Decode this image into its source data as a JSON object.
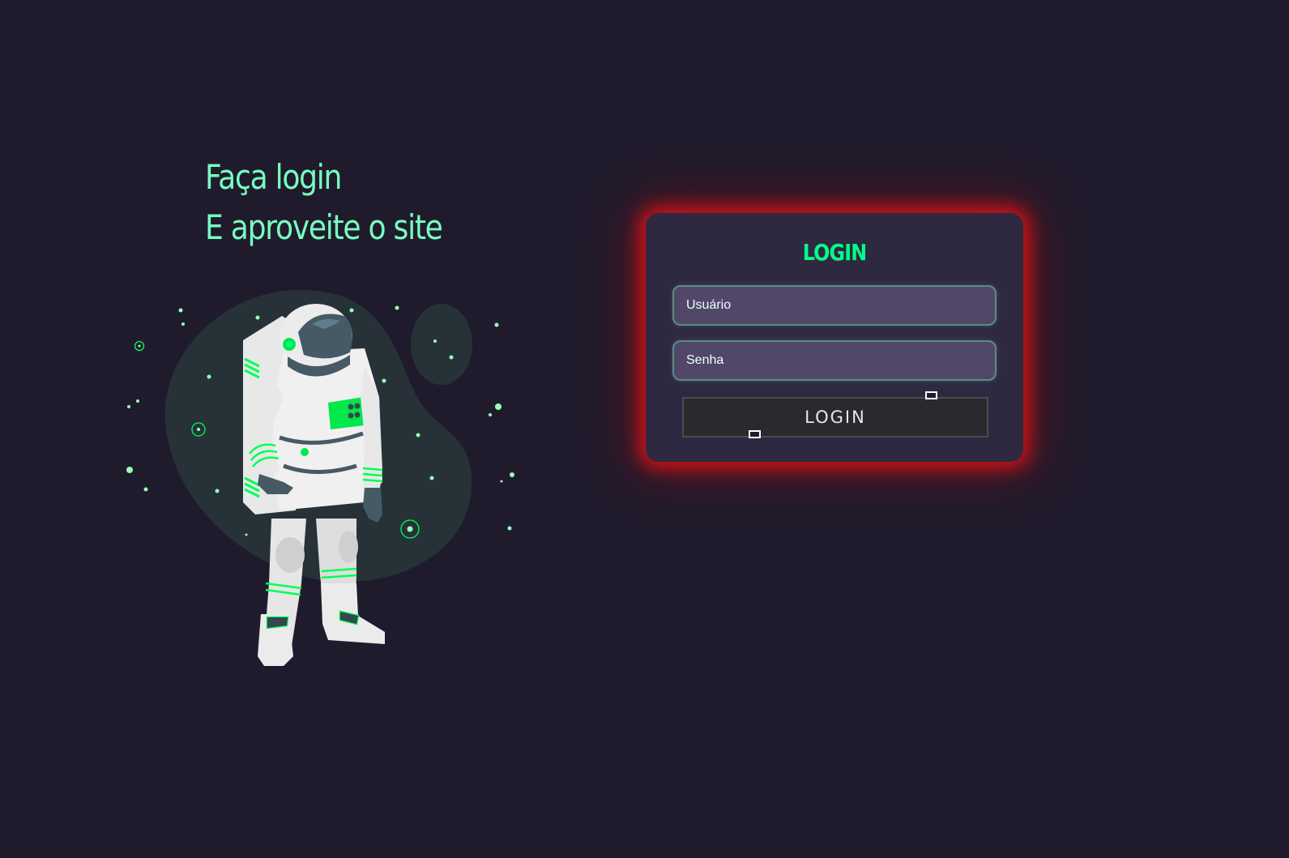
{
  "hero": {
    "line1": "Faça login",
    "line2": "E aproveite o site",
    "illustration": "astronaut-icon"
  },
  "login": {
    "title": "LOGIN",
    "username_placeholder": "Usuário",
    "password_placeholder": "Senha",
    "button_label": "LOGIN"
  },
  "colors": {
    "background": "#201b2c",
    "card": "#2f2841",
    "accent": "#00ff88",
    "headline": "#77ffc0",
    "input": "#514869",
    "glow": "#e61414"
  }
}
